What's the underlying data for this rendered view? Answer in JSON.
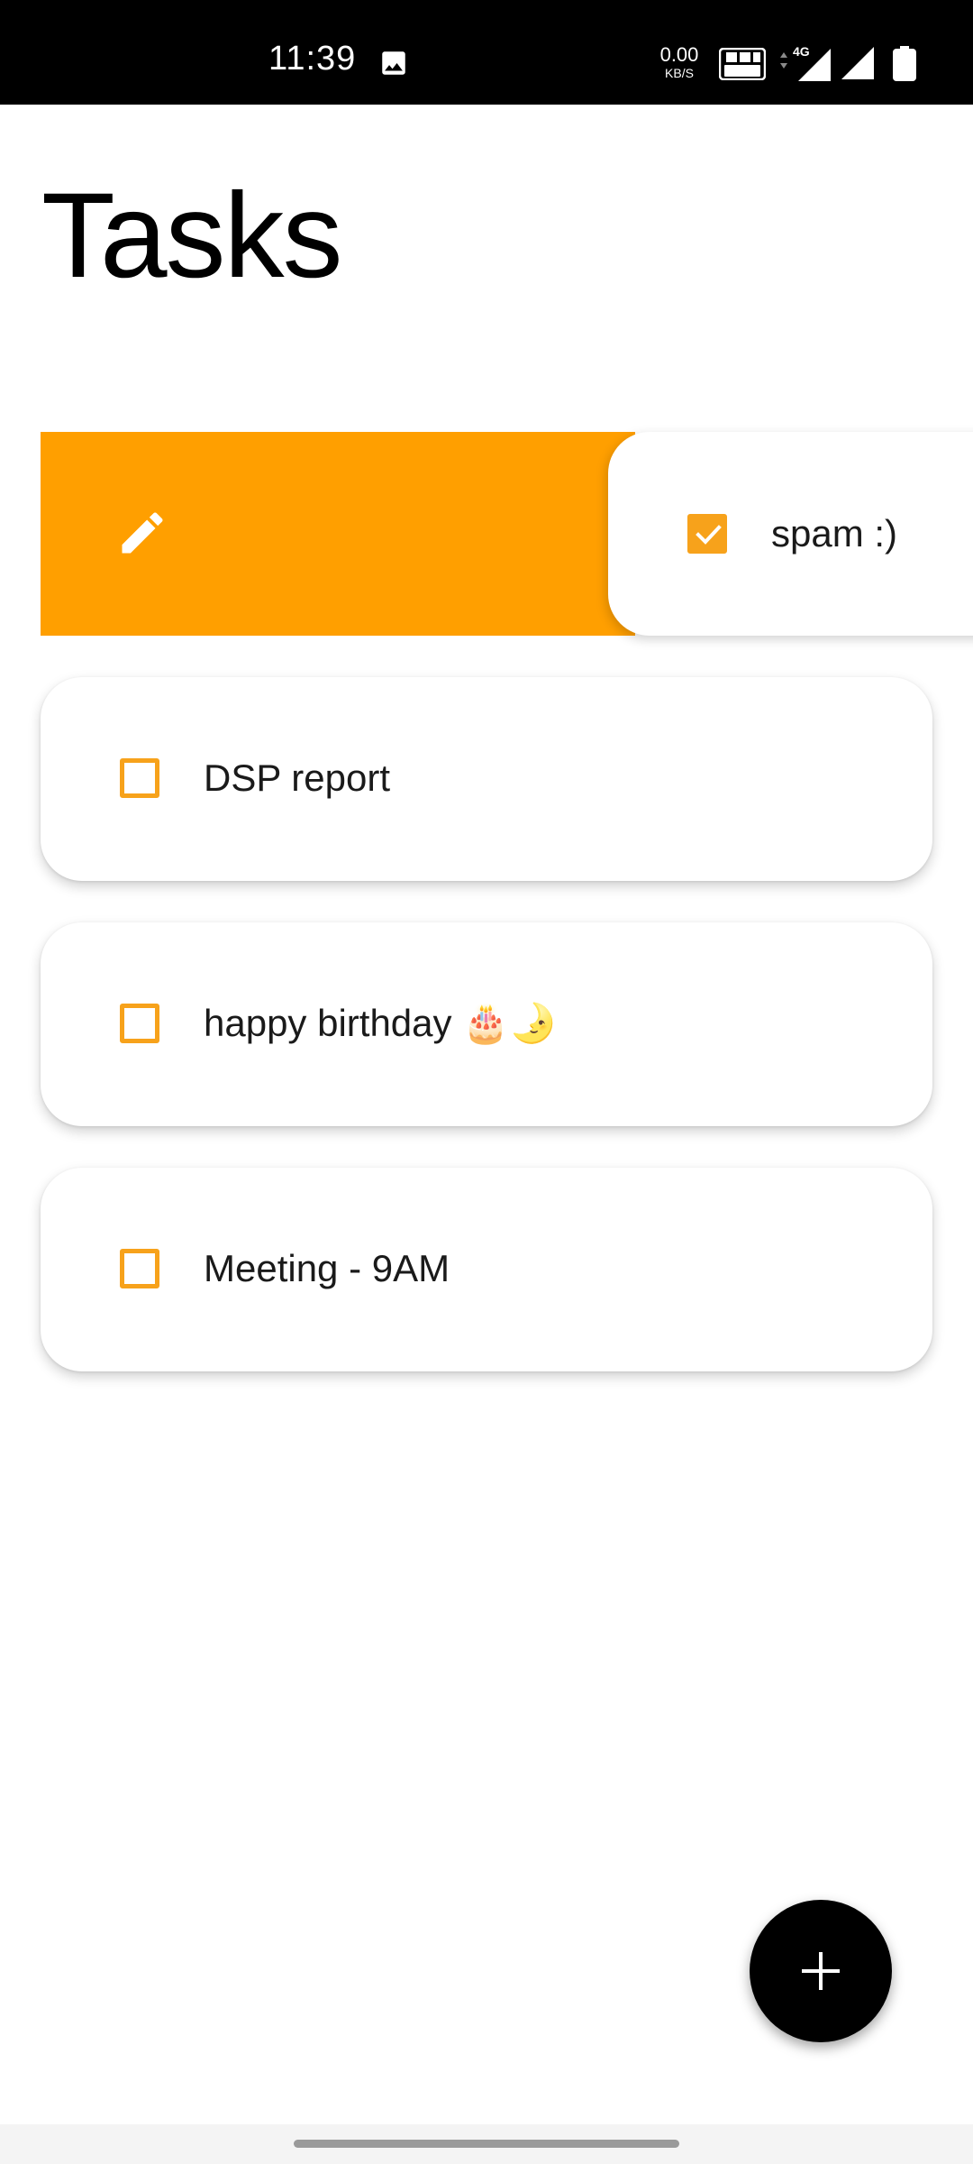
{
  "status_bar": {
    "time": "11:39",
    "net_speed_value": "0.00",
    "net_speed_unit": "KB/S",
    "network_type": "4G",
    "icons": [
      "image-icon",
      "volte-icon",
      "mobile-data-icon",
      "signal-icon",
      "battery-icon"
    ]
  },
  "header": {
    "title": "Tasks"
  },
  "swiped_task": {
    "label": "spam :)",
    "checked": true,
    "action_icon": "edit-icon",
    "action_color": "#ff9f00"
  },
  "tasks": [
    {
      "label": "DSP report",
      "checked": false
    },
    {
      "label": "happy birthday 🎂🌛",
      "checked": false
    },
    {
      "label": "Meeting - 9AM",
      "checked": false
    }
  ],
  "fab": {
    "icon": "plus-icon"
  },
  "colors": {
    "accent": "#f7a21b",
    "background": "#ffffff",
    "text": "#1a1a1a"
  }
}
